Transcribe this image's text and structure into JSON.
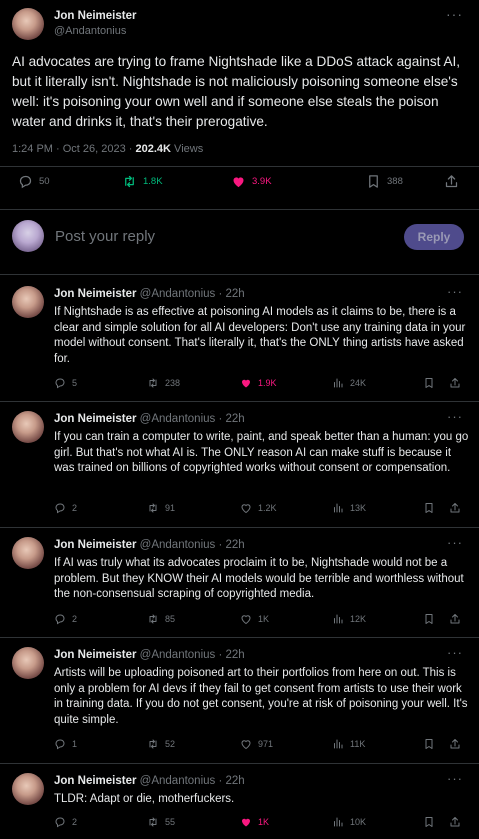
{
  "main_tweet": {
    "author_name": "Jon Neimeister",
    "author_handle": "@Andantonius",
    "more": "···",
    "body": "AI advocates are trying to frame Nightshade like a DDoS attack against AI, but it literally isn't. Nightshade is not maliciously poisoning someone else's well: it's poisoning your own well and if someone else steals the poison water and drinks it, that's their prerogative.",
    "timestamp": "1:24 PM · Oct 26, 2023 · ",
    "views_count": "202.4K",
    "views_label": " Views",
    "replies": "50",
    "reposts": "1.8K",
    "likes": "3.9K",
    "bookmarks": "388"
  },
  "composer": {
    "placeholder": "Post your reply",
    "button": "Reply"
  },
  "replies": [
    {
      "name": "Jon Neimeister",
      "handle": "@Andantonius",
      "time": " · 22h",
      "text": "If Nightshade is as effective at poisoning AI models as it claims to be, there is a clear and simple solution for all AI developers: Don't use any training data in your model without consent. That's literally it, that's the ONLY thing artists have asked for.",
      "replies": "5",
      "reposts": "238",
      "likes": "1.9K",
      "views": "24K"
    },
    {
      "name": "Jon Neimeister",
      "handle": "@Andantonius",
      "time": " · 22h",
      "text": "If you can train a computer to write, paint, and speak better than a human: you go girl. But that's not what AI is. The ONLY reason AI can make stuff is because it was trained on billions of copyrighted works without consent or compensation.",
      "replies": "2",
      "reposts": "91",
      "likes": "1.2K",
      "views": "13K"
    },
    {
      "name": "Jon Neimeister",
      "handle": "@Andantonius",
      "time": " · 22h",
      "text": "If AI was truly what its advocates proclaim it to be, Nightshade would not be a problem. But they KNOW their AI models would be terrible and worthless without the non-consensual scraping of copyrighted media.",
      "replies": "2",
      "reposts": "85",
      "likes": "1K",
      "views": "12K"
    },
    {
      "name": "Jon Neimeister",
      "handle": "@Andantonius",
      "time": " · 22h",
      "text": "Artists will be uploading poisoned art to their portfolios from here on out. This is only a problem for AI devs if they fail to get consent from artists to use their work in training data. If you do not get consent, you're at risk of poisoning your well. It's quite simple.",
      "replies": "1",
      "reposts": "52",
      "likes": "971",
      "views": "11K"
    },
    {
      "name": "Jon Neimeister",
      "handle": "@Andantonius",
      "time": " · 22h",
      "text": "TLDR: Adapt or die, motherfuckers.",
      "replies": "2",
      "reposts": "55",
      "likes": "1K",
      "views": "10K"
    }
  ],
  "colors": {
    "background": "#000000",
    "text": "#e7e9ea",
    "muted": "#71767b",
    "repost_green": "#00ba7c",
    "like_pink": "#f91880",
    "reply_button": "#4f4b8c"
  },
  "icons": [
    "reply-icon",
    "repost-icon",
    "like-icon",
    "bookmark-icon",
    "share-icon",
    "views-icon",
    "more-icon"
  ]
}
